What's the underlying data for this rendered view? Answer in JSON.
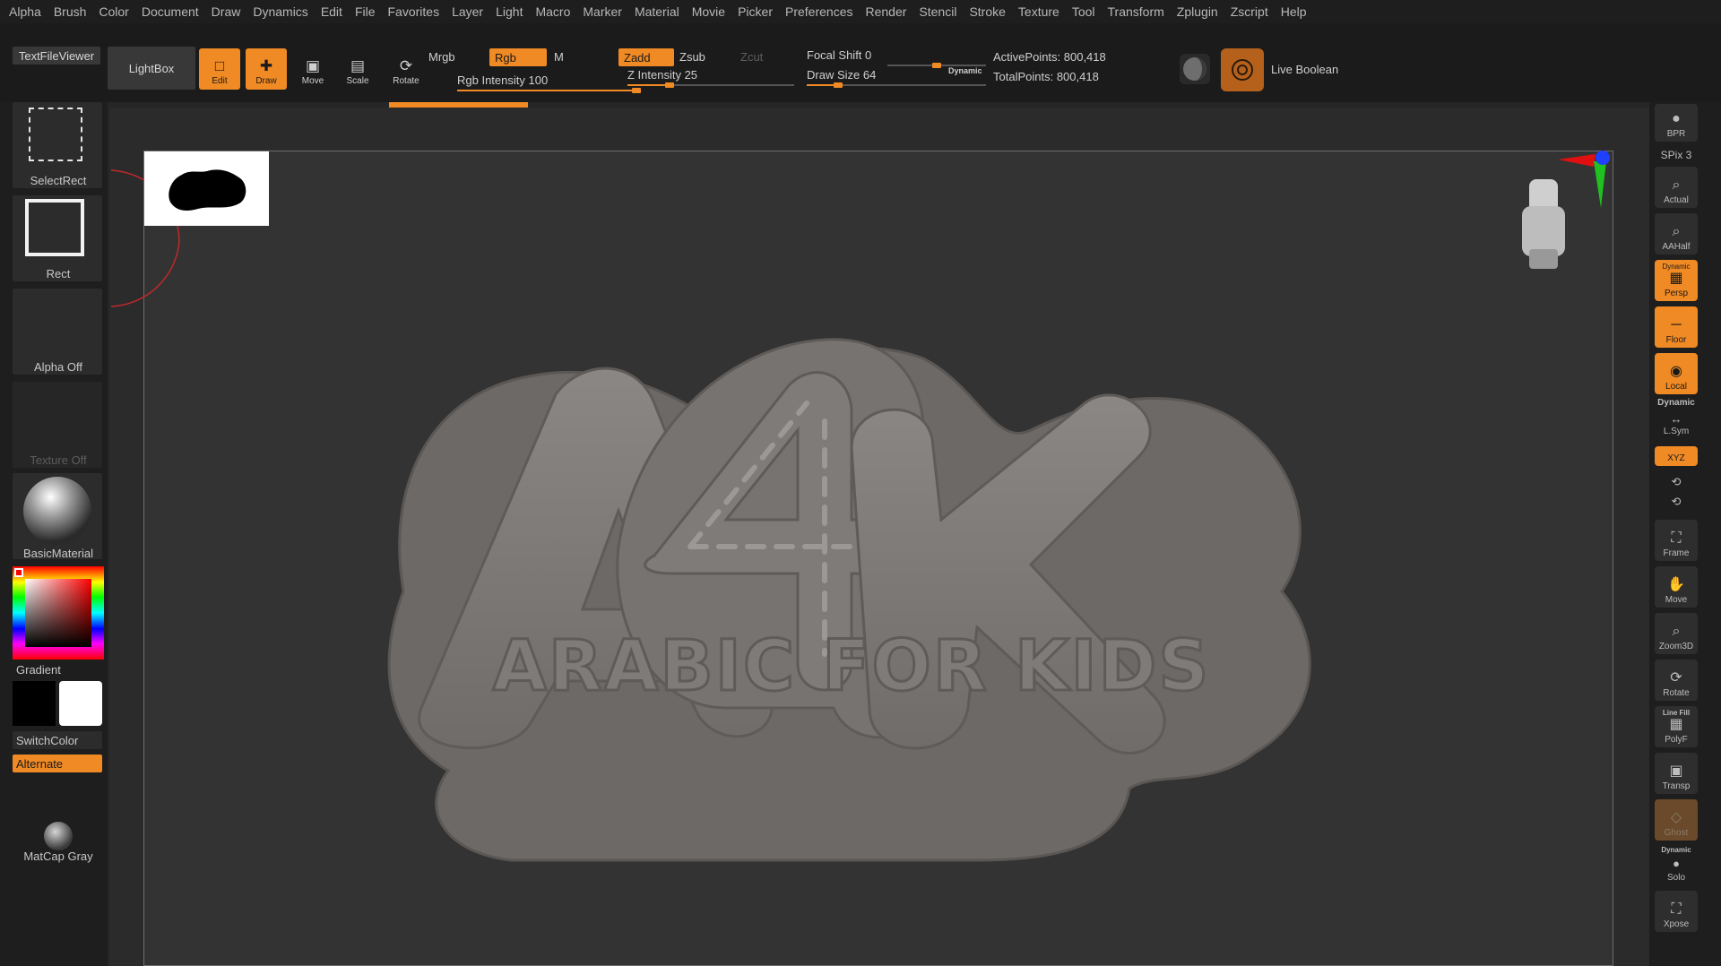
{
  "menu": [
    "Alpha",
    "Brush",
    "Color",
    "Document",
    "Draw",
    "Dynamics",
    "Edit",
    "File",
    "Favorites",
    "Layer",
    "Light",
    "Macro",
    "Marker",
    "Material",
    "Movie",
    "Picker",
    "Preferences",
    "Render",
    "Stencil",
    "Stroke",
    "Texture",
    "Tool",
    "Transform",
    "Zplugin",
    "Zscript",
    "Help"
  ],
  "toolbar": {
    "textfileviewer": "TextFileViewer",
    "lightbox": "LightBox",
    "edit": "Edit",
    "draw": "Draw",
    "move": "Move",
    "scale": "Scale",
    "rotate": "Rotate",
    "mrgb": "Mrgb",
    "rgb": "Rgb",
    "m": "M",
    "rgb_intensity": "Rgb Intensity 100",
    "zadd": "Zadd",
    "zsub": "Zsub",
    "zcut": "Zcut",
    "z_intensity": "Z Intensity 25",
    "focal_shift": "Focal Shift 0",
    "draw_size": "Draw Size 64",
    "dynamic": "Dynamic",
    "active_points": "ActivePoints: 800,418",
    "total_points": "TotalPoints: 800,418",
    "live_boolean": "Live Boolean",
    "rgb_intensity_value": 100,
    "z_intensity_value": 25,
    "focal_shift_value": 0,
    "draw_size_value": 64
  },
  "left_shelf": {
    "select_rect": "SelectRect",
    "rect": "Rect",
    "alpha_off": "Alpha Off",
    "texture_off": "Texture Off",
    "basic_material": "BasicMaterial",
    "gradient": "Gradient",
    "switch_color": "SwitchColor",
    "alternate": "Alternate",
    "matcap_gray": "MatCap Gray"
  },
  "canvas": {
    "logo_main": "A4K",
    "logo_sub": "ARABIC FOR KIDS"
  },
  "right_shelf": {
    "bpr": "BPR",
    "spix": "SPix 3",
    "actual": "Actual",
    "aahalf": "AAHalf",
    "dynamic_top": "Dynamic",
    "persp": "Persp",
    "floor": "Floor",
    "local": "Local",
    "dynamic": "Dynamic",
    "lsym": "L.Sym",
    "xyz": "XYZ",
    "frame": "Frame",
    "move": "Move",
    "zoom3d": "Zoom3D",
    "rotate": "Rotate",
    "line_fill": "Line Fill",
    "polyf": "PolyF",
    "transp": "Transp",
    "ghost": "Ghost",
    "dynamic_solo": "Dynamic",
    "solo": "Solo",
    "xpose": "Xpose"
  },
  "colors": {
    "accent": "#f08a24",
    "bg": "#1e1e1e",
    "canvas": "#333333",
    "sculpt_gray": "#7a7775"
  }
}
